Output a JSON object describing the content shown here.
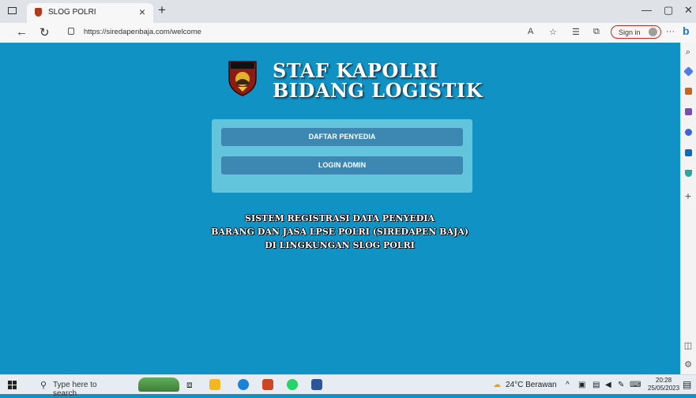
{
  "browser": {
    "tab_title": "SLOG POLRI",
    "tab_close": "×",
    "new_tab": "+",
    "url": "https://siredapenbaja.com/welcome",
    "sign_in": "Sign in",
    "minimize": "—",
    "restore": "▢",
    "close": "✕",
    "back": "←",
    "refresh": "↻",
    "more": "···"
  },
  "page": {
    "heading_line1": "STAF KAPOLRI",
    "heading_line2": "BIDANG LOGISTIK",
    "buttons": {
      "daftar": "DAFTAR PENYEDIA",
      "login": "LOGIN ADMIN"
    },
    "caption_line1": "SISTEM REGISTRASI DATA PENYEDIA",
    "caption_line2": "BARANG DAN JASA LPSE POLRI (SIREDAPEN BAJA)",
    "caption_line3": "DI LINGKUNGAN SLOG POLRI",
    "logo_text": "LOGISTIK"
  },
  "taskbar": {
    "search_placeholder": "Type here to search",
    "weather": "24°C  Berawan",
    "time": "20:28",
    "date": "25/05/2023",
    "notification_count": "6"
  },
  "colors": {
    "page_bg": "#1192c5",
    "panel_bg": "#63c5dc",
    "button_bg": "#3d87b3"
  }
}
